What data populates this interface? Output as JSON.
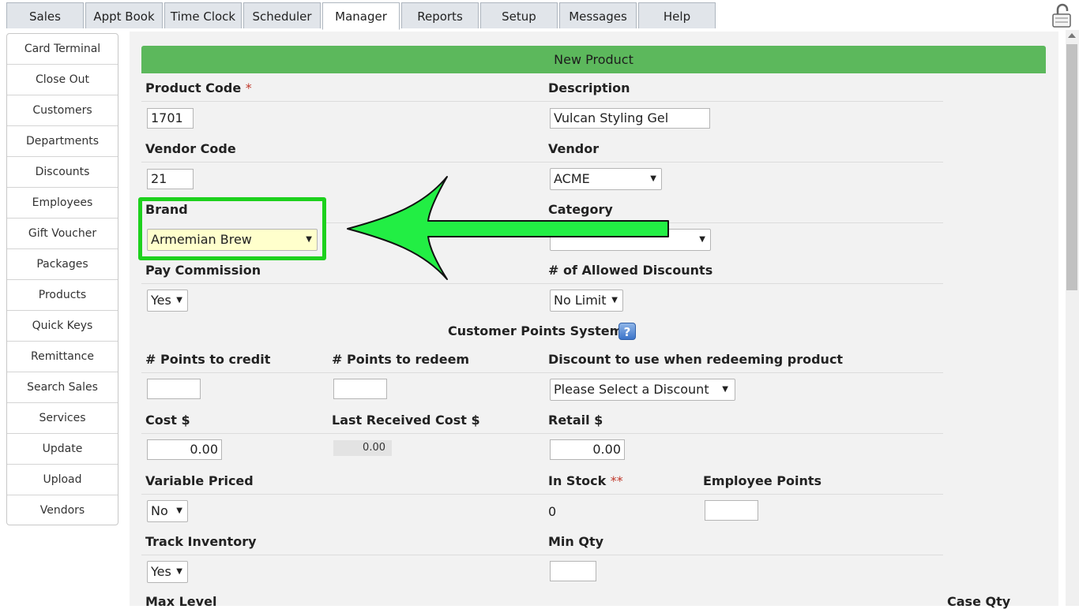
{
  "tabs": [
    {
      "label": "Sales"
    },
    {
      "label": "Appt Book"
    },
    {
      "label": "Time Clock"
    },
    {
      "label": "Scheduler"
    },
    {
      "label": "Manager",
      "active": true
    },
    {
      "label": "Reports"
    },
    {
      "label": "Setup"
    },
    {
      "label": "Messages"
    },
    {
      "label": "Help"
    }
  ],
  "sidebar": {
    "items": [
      {
        "label": "Card Terminal"
      },
      {
        "label": "Close Out"
      },
      {
        "label": "Customers"
      },
      {
        "label": "Departments"
      },
      {
        "label": "Discounts"
      },
      {
        "label": "Employees"
      },
      {
        "label": "Gift Voucher"
      },
      {
        "label": "Packages"
      },
      {
        "label": "Products"
      },
      {
        "label": "Quick Keys"
      },
      {
        "label": "Remittance"
      },
      {
        "label": "Search Sales"
      },
      {
        "label": "Services"
      },
      {
        "label": "Update"
      },
      {
        "label": "Upload"
      },
      {
        "label": "Vendors"
      }
    ]
  },
  "form": {
    "header": "New Product",
    "product_code": {
      "label": "Product Code",
      "required_mark": "*",
      "value": "1701"
    },
    "description": {
      "label": "Description",
      "value": "Vulcan Styling Gel"
    },
    "vendor_code": {
      "label": "Vendor Code",
      "value": "21"
    },
    "vendor": {
      "label": "Vendor",
      "value": "ACME"
    },
    "brand": {
      "label": "Brand",
      "value": "Armemian Brew"
    },
    "category": {
      "label": "Category",
      "value": ""
    },
    "pay_commission": {
      "label": "Pay Commission",
      "value": "Yes"
    },
    "allowed_discounts": {
      "label": "# of Allowed Discounts",
      "value": "No Limit"
    },
    "points_system": {
      "label": "Customer Points System",
      "help": "?"
    },
    "points_credit": {
      "label": "# Points to credit",
      "value": ""
    },
    "points_redeem": {
      "label": "# Points to redeem",
      "value": ""
    },
    "redeem_discount": {
      "label": "Discount to use when redeeming product",
      "value": "Please Select a Discount"
    },
    "cost": {
      "label": "Cost $",
      "value": "0.00"
    },
    "last_received_cost": {
      "label": "Last Received Cost $",
      "value": "0.00"
    },
    "retail": {
      "label": "Retail $",
      "value": "0.00"
    },
    "variable_priced": {
      "label": "Variable Priced",
      "value": "No"
    },
    "in_stock": {
      "label": "In Stock",
      "required_mark": "**",
      "value": "0"
    },
    "employee_points": {
      "label": "Employee Points",
      "value": ""
    },
    "track_inventory": {
      "label": "Track Inventory",
      "value": "Yes"
    },
    "min_qty": {
      "label": "Min Qty",
      "value": ""
    },
    "max_level": {
      "label": "Max Level"
    },
    "case_qty": {
      "label": "Case Qty"
    }
  },
  "colors": {
    "header_green": "#5cb85c",
    "highlight_green": "#1dd11d",
    "arrow_green": "#22ee44",
    "brand_select_bg": "#ffffcc"
  }
}
